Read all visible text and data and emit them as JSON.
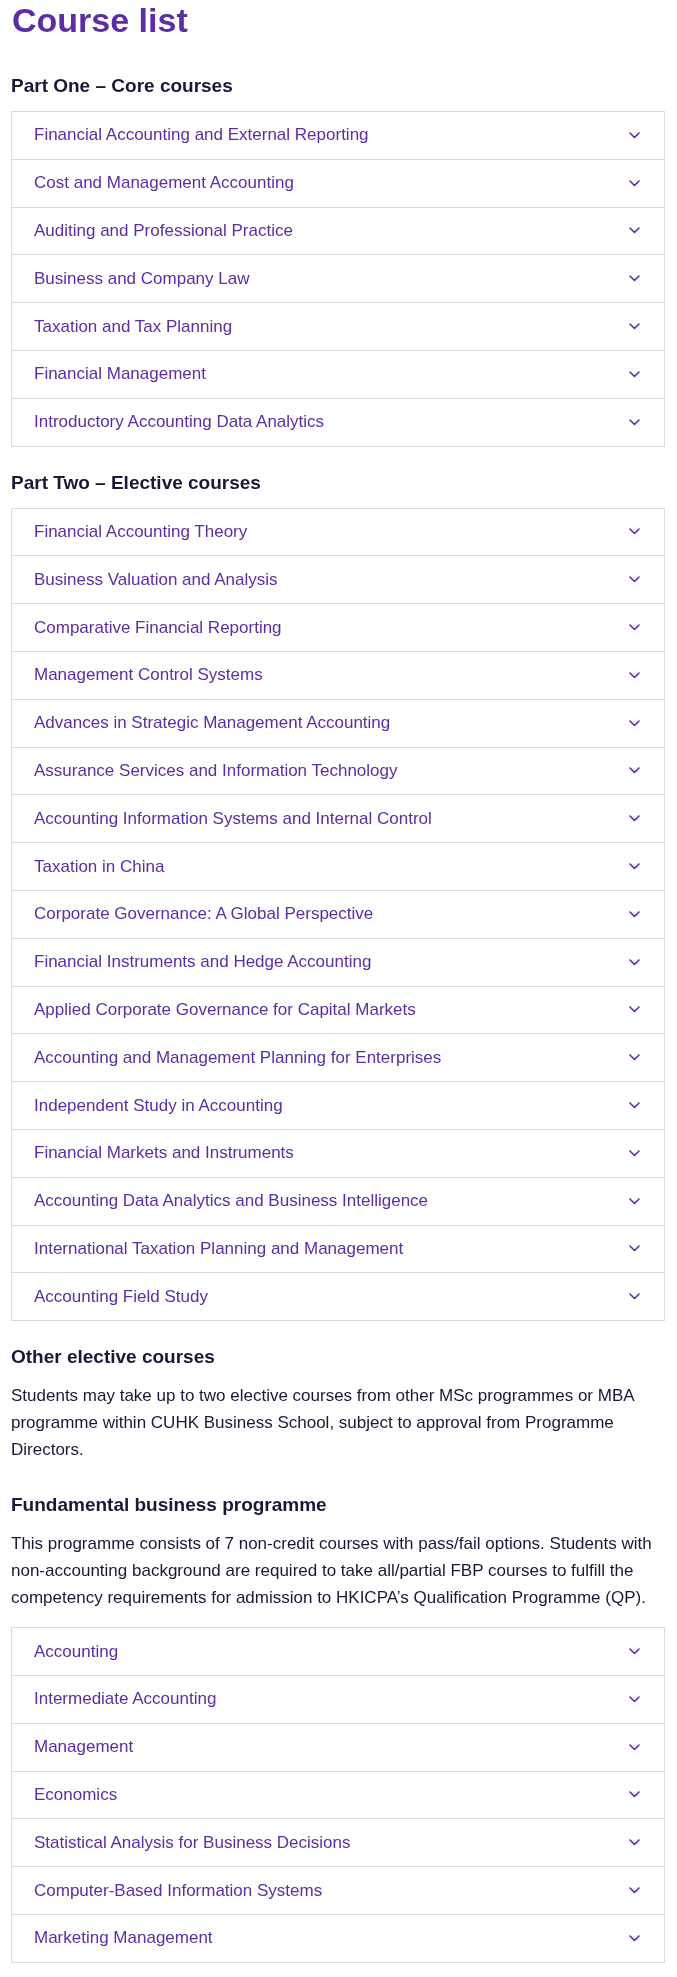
{
  "title": "Course list",
  "sections": [
    {
      "heading": "Part One – Core courses",
      "courses": [
        {
          "label": "Financial Accounting and External Reporting",
          "expanded": false
        },
        {
          "label": "Cost and Management Accounting",
          "expanded": false
        },
        {
          "label": "Auditing and Professional Practice",
          "expanded": false
        },
        {
          "label": "Business and Company Law",
          "expanded": false
        },
        {
          "label": "Taxation and Tax Planning",
          "expanded": false
        },
        {
          "label": "Financial Management",
          "expanded": false
        },
        {
          "label": "Introductory Accounting Data Analytics",
          "expanded": false
        }
      ]
    },
    {
      "heading": "Part Two – Elective courses",
      "courses": [
        {
          "label": "Financial Accounting Theory",
          "expanded": false
        },
        {
          "label": "Business Valuation and Analysis",
          "expanded": false
        },
        {
          "label": "Comparative Financial Reporting",
          "expanded": false
        },
        {
          "label": "Management Control Systems",
          "expanded": false
        },
        {
          "label": "Advances in Strategic Management Accounting",
          "expanded": false
        },
        {
          "label": "Assurance Services and Information Technology",
          "expanded": false
        },
        {
          "label": "Accounting Information Systems and Internal Control",
          "expanded": false
        },
        {
          "label": "Taxation in China",
          "expanded": false
        },
        {
          "label": "Corporate Governance: A Global Perspective",
          "expanded": false
        },
        {
          "label": "Financial Instruments and Hedge Accounting",
          "expanded": false
        },
        {
          "label": "Applied Corporate Governance for Capital Markets",
          "expanded": false
        },
        {
          "label": "Accounting and Management Planning for Enterprises",
          "expanded": false
        },
        {
          "label": "Independent Study in Accounting",
          "expanded": false
        },
        {
          "label": "Financial Markets and Instruments",
          "expanded": false
        },
        {
          "label": "Accounting Data Analytics and Business Intelligence",
          "expanded": false
        },
        {
          "label": "International Taxation Planning and Management",
          "expanded": false
        },
        {
          "label": "Accounting Field Study",
          "expanded": false
        }
      ]
    },
    {
      "heading": "Other elective courses",
      "text": "Students may take up to two elective courses from other MSc programmes or MBA programme within CUHK Business School, subject to approval from Programme Directors."
    },
    {
      "heading": "Fundamental business programme",
      "text": "This programme consists of 7 non-credit courses with pass/fail options. Students with non-accounting background are required to take all/partial FBP courses to fulfill the competency requirements for admission to HKICPA’s Qualification Programme (QP).",
      "courses": [
        {
          "label": "Accounting",
          "expanded": false
        },
        {
          "label": "Intermediate Accounting",
          "expanded": false
        },
        {
          "label": "Management",
          "expanded": false
        },
        {
          "label": "Economics",
          "expanded": false
        },
        {
          "label": "Statistical Analysis for Business Decisions",
          "expanded": false
        },
        {
          "label": "Computer-Based Information Systems",
          "expanded": false
        },
        {
          "label": "Marketing Management",
          "expanded": false
        }
      ]
    }
  ]
}
